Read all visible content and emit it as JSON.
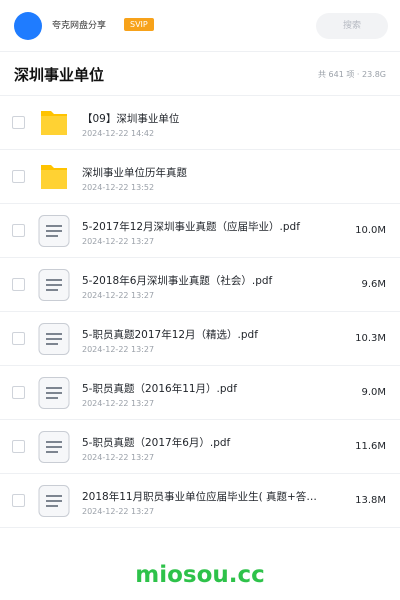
{
  "header": {
    "app_name": "夸克网盘分享",
    "badge": "SVIP",
    "search_placeholder": "搜索"
  },
  "folder": {
    "title": "深圳事业单位",
    "summary": "共 641 项 · 23.8G"
  },
  "colors": {
    "avatar": "#1f7cff",
    "badge": "#f7a21a",
    "folder_icon": "#ffc300",
    "watermark": "#2ec24a"
  },
  "files": [
    {
      "type": "folder",
      "icon": "folder-icon",
      "name": "【09】深圳事业单位",
      "date": "2024-12-22 14:42",
      "size": ""
    },
    {
      "type": "folder",
      "icon": "folder-icon",
      "name": "深圳事业单位历年真题",
      "date": "2024-12-22 13:52",
      "size": ""
    },
    {
      "type": "file",
      "icon": "document-icon",
      "name": "5-2017年12月深圳事业真题（应届毕业）.pdf",
      "date": "2024-12-22 13:27",
      "size": "10.0M"
    },
    {
      "type": "file",
      "icon": "document-icon",
      "name": "5-2018年6月深圳事业真题（社会）.pdf",
      "date": "2024-12-22 13:27",
      "size": "9.6M"
    },
    {
      "type": "file",
      "icon": "document-icon",
      "name": "5-职员真题2017年12月（精选）.pdf",
      "date": "2024-12-22 13:27",
      "size": "10.3M"
    },
    {
      "type": "file",
      "icon": "document-icon",
      "name": "5-职员真题（2016年11月）.pdf",
      "date": "2024-12-22 13:27",
      "size": "9.0M"
    },
    {
      "type": "file",
      "icon": "document-icon",
      "name": "5-职员真题（2017年6月）.pdf",
      "date": "2024-12-22 13:27",
      "size": "11.6M"
    },
    {
      "type": "file",
      "icon": "document-icon",
      "name": "2018年11月职员事业单位应届毕业生( 真题+答…",
      "date": "2024-12-22 13:27",
      "size": "13.8M"
    }
  ],
  "watermark": "miosou.cc"
}
